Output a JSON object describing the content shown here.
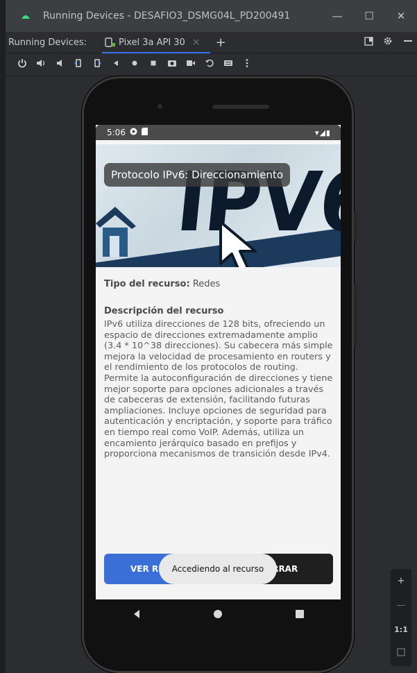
{
  "window": {
    "title": "Running Devices - DESAFIO3_DSMG04L_PD200491",
    "controls": [
      "—",
      "☐",
      "✕"
    ]
  },
  "tabbar": {
    "label": "Running Devices:",
    "tab_name": "Pixel 3a API 30",
    "tab_close": "×",
    "add": "+"
  },
  "toolbar": {
    "icons": [
      "power-icon",
      "volume-up-icon",
      "volume-down-icon",
      "rotate-left-icon",
      "rotate-right-icon",
      "back-icon",
      "home-icon",
      "overview-icon",
      "screenshot-icon",
      "record-icon",
      "undo-icon",
      "keyboard-icon",
      "more-icon"
    ]
  },
  "device": {
    "status": {
      "time": "5:06",
      "signal": "▾◢▮"
    },
    "hero": {
      "image_text": "IPV6",
      "title": "Protocolo IPv6: Direccionamiento"
    },
    "resource": {
      "type_label": "Tipo del recurso:",
      "type_value": "Redes",
      "desc_label": "Descripción del recurso",
      "description": "IPv6 utiliza direcciones de 128 bits, ofreciendo un espacio de direcciones extremadamente amplio (3.4 * 10^38 direcciones). Su cabecera más simple mejora la velocidad de procesamiento en routers y el rendimiento de los protocolos de routing. Permite la autoconfiguración de direcciones y tiene mejor soporte para opciones adicionales a través de cabeceras de extensión, facilitando futuras ampliaciones. Incluye opciones de seguridad para autenticación y encriptación, y soporte para tráfico en tiempo real como VoIP. Además, utiliza un encamiento jerárquico basado en prefijos y proporciona mecanismos de transición desde IPv4."
    },
    "buttons": {
      "view": "VER RECU",
      "close": "ERRAR"
    },
    "toast": "Accediendo al recurso"
  },
  "zoom": {
    "plus": "+",
    "minus": "—",
    "ratio": "1:1"
  }
}
